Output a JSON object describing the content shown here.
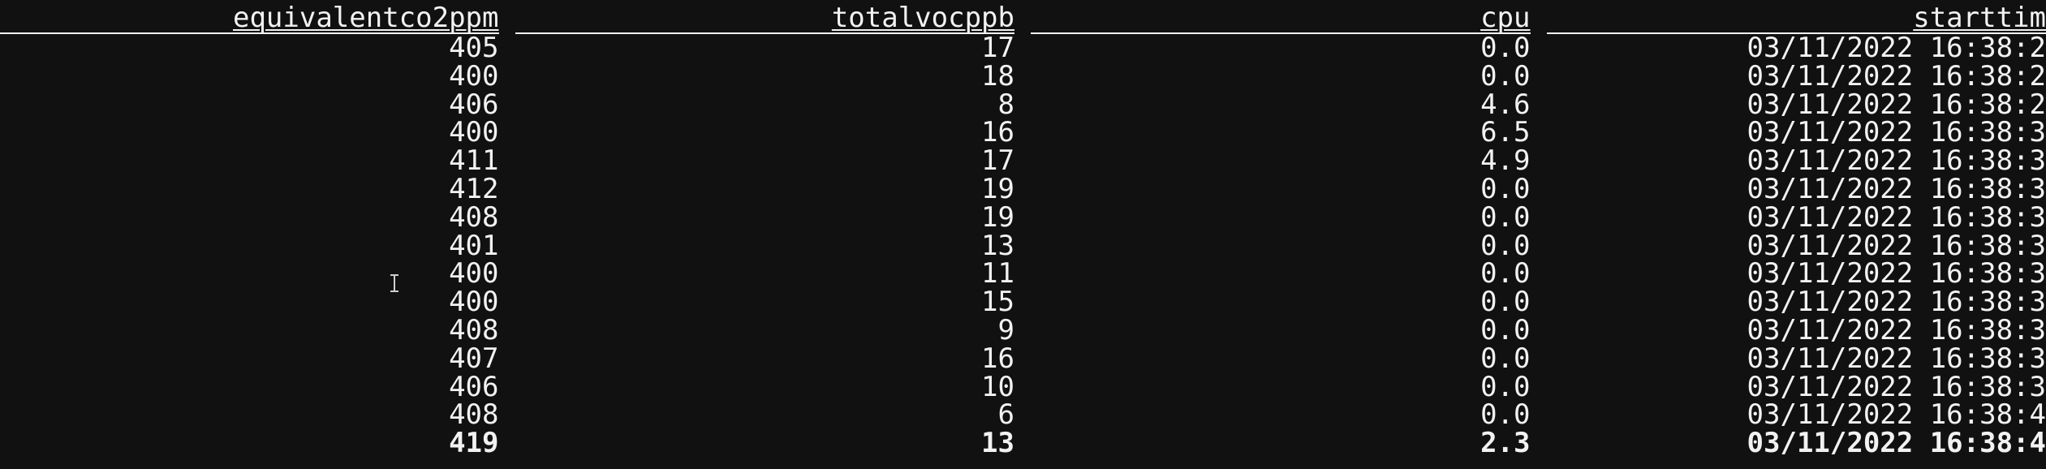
{
  "table": {
    "columns": [
      "equivalentco2ppm",
      "totalvocppb",
      "cpu",
      "starttim"
    ],
    "rows": [
      [
        "405",
        "17",
        "0.0",
        "03/11/2022 16:38:2"
      ],
      [
        "400",
        "18",
        "0.0",
        "03/11/2022 16:38:2"
      ],
      [
        "406",
        "8",
        "4.6",
        "03/11/2022 16:38:2"
      ],
      [
        "400",
        "16",
        "6.5",
        "03/11/2022 16:38:3"
      ],
      [
        "411",
        "17",
        "4.9",
        "03/11/2022 16:38:3"
      ],
      [
        "412",
        "19",
        "0.0",
        "03/11/2022 16:38:3"
      ],
      [
        "408",
        "19",
        "0.0",
        "03/11/2022 16:38:3"
      ],
      [
        "401",
        "13",
        "0.0",
        "03/11/2022 16:38:3"
      ],
      [
        "400",
        "11",
        "0.0",
        "03/11/2022 16:38:3"
      ],
      [
        "400",
        "15",
        "0.0",
        "03/11/2022 16:38:3"
      ],
      [
        "408",
        "9",
        "0.0",
        "03/11/2022 16:38:3"
      ],
      [
        "407",
        "16",
        "0.0",
        "03/11/2022 16:38:3"
      ],
      [
        "406",
        "10",
        "0.0",
        "03/11/2022 16:38:3"
      ],
      [
        "408",
        "6",
        "0.0",
        "03/11/2022 16:38:4"
      ],
      [
        "419",
        "13",
        "2.3",
        "03/11/2022 16:38:4"
      ]
    ],
    "highlighted_row": 14
  },
  "cursor": {
    "icon": "text-ibeam-cursor-icon"
  },
  "colors": {
    "background": "#111111",
    "foreground": "#f2f2f2"
  }
}
